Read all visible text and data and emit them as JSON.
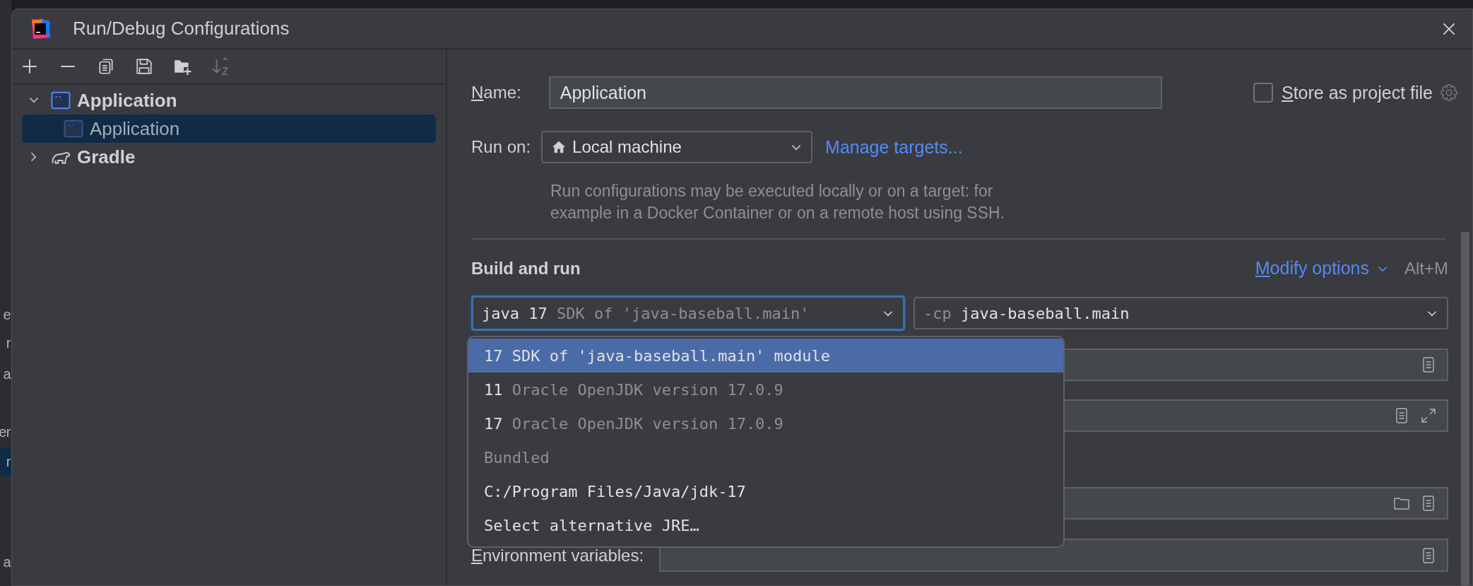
{
  "editor_lines": [
    {
      "text": "e",
      "selected": false
    },
    {
      "text": "r",
      "selected": false
    },
    {
      "text": "a",
      "selected": false
    },
    {
      "text": "er",
      "selected": false
    },
    {
      "text": "r",
      "selected": true
    },
    {
      "text": "a",
      "selected": false
    }
  ],
  "window": {
    "title": "Run/Debug Configurations"
  },
  "toolbar": [
    {
      "kind": "add",
      "disabled": false
    },
    {
      "kind": "remove",
      "disabled": false
    },
    {
      "kind": "copy",
      "disabled": false
    },
    {
      "kind": "save",
      "disabled": false
    },
    {
      "kind": "folder",
      "disabled": false
    },
    {
      "kind": "sort",
      "disabled": true
    }
  ],
  "tree": [
    {
      "label": "Application",
      "kind": "application",
      "expanded": true,
      "selected": false,
      "children": [
        {
          "label": "Application",
          "kind": "application",
          "selected": true
        }
      ]
    },
    {
      "label": "Gradle",
      "kind": "gradle",
      "expanded": false,
      "selected": false
    }
  ],
  "form": {
    "name_label": "Name:",
    "name_value": "Application",
    "store_as_project_file": {
      "label": "Store as project file",
      "checked": false
    },
    "run_on_label": "Run on:",
    "run_on_value": "Local machine",
    "manage_targets": "Manage targets...",
    "run_on_help": "Run configurations may be executed locally or on a target: for example in a Docker Container or on a remote host using SSH.",
    "section_title": "Build and run",
    "modify_options": "Modify options",
    "modify_shortcut": "Alt+M",
    "jre": {
      "value": "java 17",
      "hint": "SDK of 'java-baseball.main'"
    },
    "classpath": {
      "flag": "-cp",
      "value": "java-baseball.main"
    },
    "env_label": "Environment variables:"
  },
  "jre_dropdown": [
    {
      "kind": "sdk",
      "version": "17",
      "detail": "SDK of 'java-baseball.main' module",
      "selected": true
    },
    {
      "kind": "sdk",
      "version": "11",
      "detail": "Oracle OpenJDK version 17.0.9",
      "selected": false
    },
    {
      "kind": "sdk",
      "version": "17",
      "detail": "Oracle OpenJDK version 17.0.9",
      "selected": false
    },
    {
      "kind": "group",
      "label": "Bundled",
      "selected": false
    },
    {
      "kind": "path",
      "label": "C:/Program Files/Java/jdk-17",
      "selected": false
    },
    {
      "kind": "action",
      "label": "Select alternative JRE…",
      "selected": false
    }
  ]
}
